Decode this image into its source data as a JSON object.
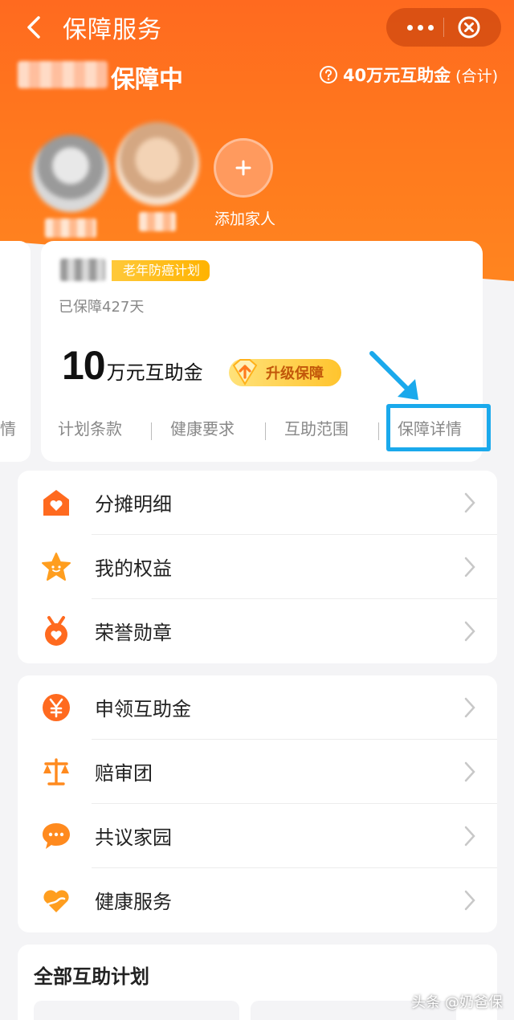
{
  "nav": {
    "title": "保障服务",
    "back_icon": "chevron-left-icon",
    "more_icon": "more-dots-icon",
    "close_icon": "close-circle-icon"
  },
  "status": {
    "label": "保障中",
    "fund_total": "40万元互助金",
    "fund_total_note": "(合计)",
    "help_icon": "question-circle-icon"
  },
  "members": {
    "add_label": "添加家人",
    "add_icon": "plus-icon"
  },
  "plan": {
    "tag": "老年防癌计划",
    "days": "已保障427天",
    "amount_num": "10",
    "amount_unit": "万元互助金",
    "upgrade_label": "升级保障",
    "links": [
      "计划条款",
      "健康要求",
      "互助范围",
      "保障详情"
    ],
    "side_link": "情"
  },
  "menu_group_1": [
    {
      "label": "分摊明细",
      "icon": "house-heart-icon"
    },
    {
      "label": "我的权益",
      "icon": "star-icon"
    },
    {
      "label": "荣誉勋章",
      "icon": "medal-heart-icon"
    }
  ],
  "menu_group_2": [
    {
      "label": "申领互助金",
      "icon": "yuan-coin-icon"
    },
    {
      "label": "赔审团",
      "icon": "scale-icon"
    },
    {
      "label": "共议家园",
      "icon": "chat-bubble-icon"
    },
    {
      "label": "健康服务",
      "icon": "hand-heart-icon"
    }
  ],
  "all_plans": {
    "title": "全部互助计划"
  },
  "watermark": "头条 @奶爸保",
  "colors": {
    "brand_orange": "#ff6a1f",
    "accent_yellow": "#ffc42e",
    "highlight_blue": "#1aa9ec"
  }
}
